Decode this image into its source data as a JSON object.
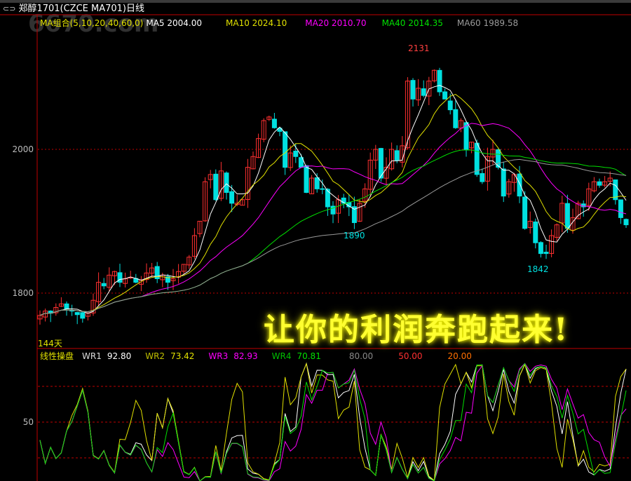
{
  "header": {
    "link_icon": "link-icon",
    "title": "郑醇1701(CZCE MA701)日线"
  },
  "watermark": "6670.com",
  "ma_legend": {
    "group": "MA组合(5,10,20,40,60,0)",
    "ma5": "MA5 2004.00",
    "ma10": "MA10 2024.10",
    "ma20": "MA20 2010.70",
    "ma40": "MA40 2014.35",
    "ma60": "MA60 1989.58"
  },
  "wr_legend": {
    "name": "线性操盘",
    "wr1_label": "WR1",
    "wr1": "92.80",
    "wr2_label": "WR2",
    "wr2": "73.42",
    "wr3_label": "WR3",
    "wr3": "82.93",
    "wr4_label": "WR4",
    "wr4": "70.81",
    "l80": "80.00",
    "l50": "50.00",
    "l20": "20.00"
  },
  "banner": "让你的利润奔跑起来!",
  "colors": {
    "up": "#ff3030",
    "down": "#00e0e0",
    "ma5": "#ffffff",
    "ma10": "#e0e000",
    "ma20": "#ff00ff",
    "ma40": "#00e000",
    "ma60": "#9a9a9a",
    "grid": "#c00000"
  },
  "chart_data": {
    "type": "candlestick",
    "title": "郑醇1701(CZCE MA701)日线",
    "y_ticks": [
      "2000",
      "1800"
    ],
    "price_range": [
      1735,
      2200
    ],
    "annotations": {
      "high": "2131",
      "low1": "1890",
      "low2": "1842",
      "days": "144天"
    },
    "closes": [
      1769,
      1775,
      1772,
      1780,
      1785,
      1778,
      1775,
      1770,
      1765,
      1772,
      1790,
      1815,
      1810,
      1825,
      1830,
      1815,
      1820,
      1822,
      1815,
      1818,
      1828,
      1835,
      1820,
      1825,
      1815,
      1820,
      1830,
      1840,
      1850,
      1880,
      1900,
      1955,
      1965,
      1930,
      1970,
      1940,
      1925,
      1925,
      1930,
      1975,
      1990,
      2015,
      2040,
      2045,
      2030,
      2025,
      1975,
      1995,
      1990,
      1975,
      1940,
      1960,
      1945,
      1945,
      1920,
      1910,
      1930,
      1925,
      1920,
      1898,
      1925,
      1945,
      1985,
      2000,
      1960,
      1975,
      2000,
      1985,
      2005,
      2095,
      2070,
      2085,
      2075,
      2095,
      2110,
      2080,
      2070,
      2055,
      2030,
      2040,
      2000,
      2010,
      1965,
      1955,
      1990,
      2000,
      1975,
      1935,
      1955,
      1965,
      1935,
      1890,
      1900,
      1870,
      1855,
      1855,
      1880,
      1895,
      1925,
      1890,
      1905,
      1925,
      1920,
      1945,
      1955,
      1950,
      1955,
      1960,
      1930,
      1905,
      1895
    ],
    "ma_periods": [
      5,
      10,
      20,
      40,
      60
    ],
    "wr_panel": {
      "y_tick": "50",
      "levels": [
        80,
        50,
        20
      ],
      "range": [
        0,
        100
      ],
      "periods": [
        10,
        6,
        20,
        14
      ]
    }
  }
}
